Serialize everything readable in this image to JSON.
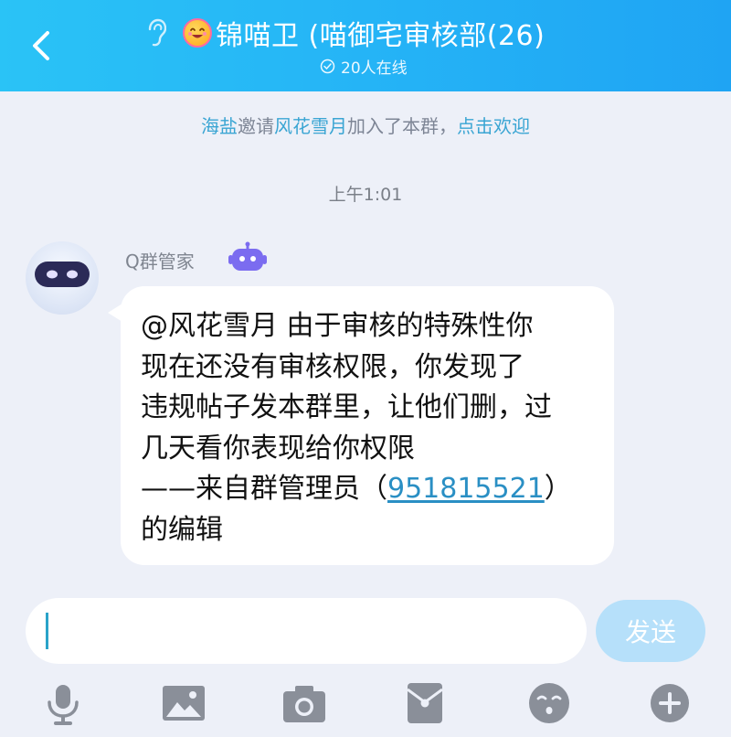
{
  "header": {
    "title": "锦喵卫 (喵御宅审核部(26)",
    "online": "20人在线"
  },
  "notice": {
    "inviter": "海盐",
    "verb": "邀请",
    "invitee": "风花雪月",
    "suffix": "加入了本群，",
    "action": "点击欢迎"
  },
  "timestamp": "上午1:01",
  "message": {
    "sender": "Q群管家",
    "lines": [
      "@风花雪月 由于审核的特殊性你",
      "现在还没有审核权限，你发现了",
      "违规帖子发本群里，让他们删，过",
      "几天看你表现给你权限"
    ],
    "signature_prefix": "——来自群管理员（",
    "admin_id": "951815521",
    "signature_suffix": "）",
    "last_line": "的编辑"
  },
  "input": {
    "send_label": "发送"
  },
  "toolbar": {
    "icons": [
      "microphone-icon",
      "image-icon",
      "camera-icon",
      "red-packet-icon",
      "emoji-icon",
      "plus-icon"
    ]
  },
  "colors": {
    "header_gradient_start": "#2ac3f6",
    "header_gradient_end": "#1fa4f3",
    "link": "#3aa5d3",
    "send_button": "#b6e0fa",
    "bot_badge": "#7b6cf0"
  }
}
